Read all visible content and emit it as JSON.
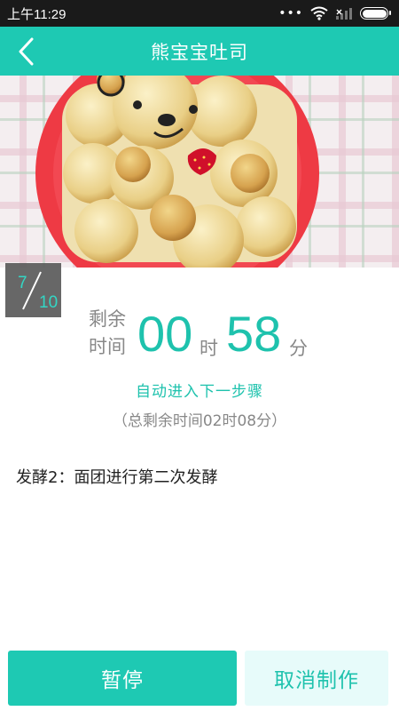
{
  "status_bar": {
    "time": "上午11:29",
    "dots": "•••",
    "icons": [
      "wifi-icon",
      "signal-icon",
      "battery-icon"
    ]
  },
  "header": {
    "title": "熊宝宝吐司",
    "back_icon": "chevron-left-icon"
  },
  "hero": {
    "description_icon": "bear-bread-photo"
  },
  "step": {
    "current": "7",
    "total": "10"
  },
  "timer": {
    "label_line1": "剩余",
    "label_line2": "时间",
    "hours": "00",
    "hours_unit": "时",
    "minutes": "58",
    "minutes_unit": "分"
  },
  "auto_next": "自动进入下一步骤",
  "total_remaining": "（总剩余时间02时08分）",
  "step_description": "发酵2：面团进行第二次发酵",
  "actions": {
    "pause_label": "暂停",
    "cancel_label": "取消制作"
  },
  "colors": {
    "accent": "#1ec9b3",
    "accent_text": "#1ec2ad",
    "cancel_bg": "#e7fbfa",
    "status_bar": "#1a1a1a"
  }
}
